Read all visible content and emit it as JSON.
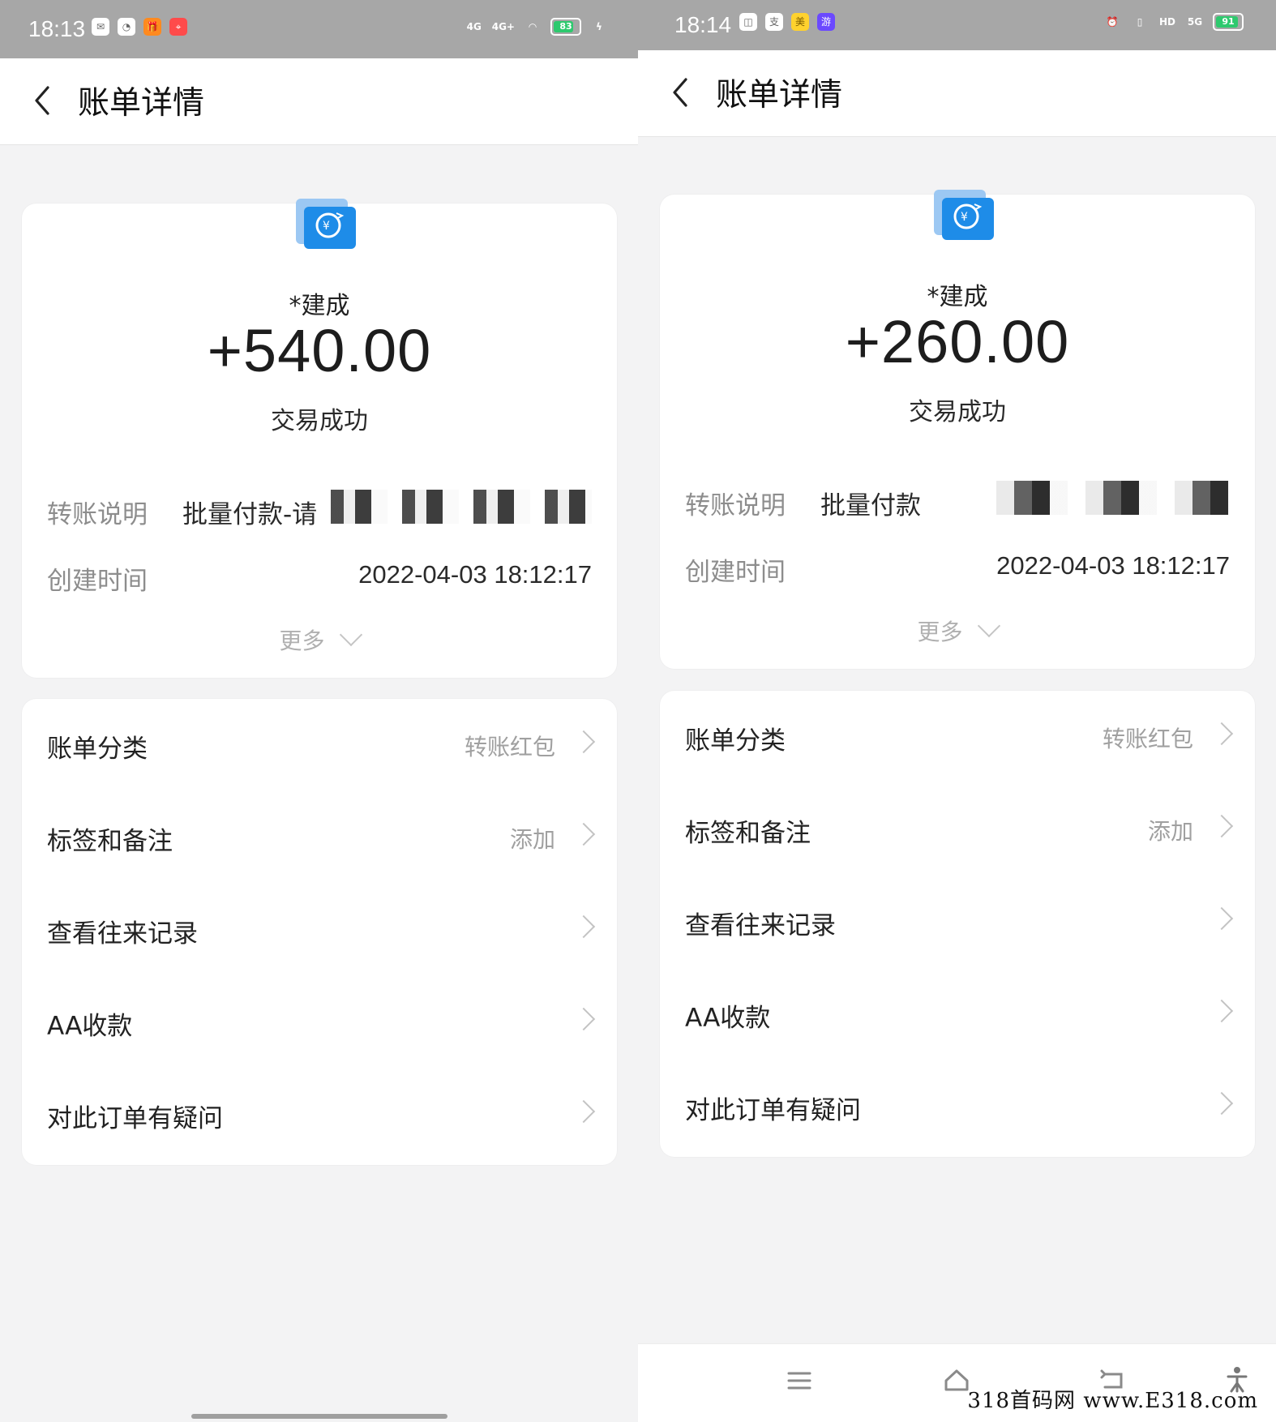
{
  "screens": [
    {
      "status": {
        "time": "18:13",
        "apps": [
          "mail",
          "compass",
          "gift",
          "map"
        ],
        "signals": [
          "4G",
          "4G+"
        ],
        "battery": "83",
        "battery_fill": 0.83
      },
      "nav": {
        "title": "账单详情"
      },
      "summary": {
        "name": "*建成",
        "amount": "+540.00",
        "status": "交易成功",
        "rows": [
          {
            "label": "转账说明",
            "value": "批量付款-请"
          },
          {
            "label": "创建时间",
            "value": "2022-04-03 18:12:17"
          }
        ],
        "more": "更多"
      },
      "menu": [
        {
          "label": "账单分类",
          "value": "转账红包"
        },
        {
          "label": "标签和备注",
          "value": "添加"
        },
        {
          "label": "查看往来记录",
          "value": ""
        },
        {
          "label": "AA收款",
          "value": ""
        },
        {
          "label": "对此订单有疑问",
          "value": ""
        }
      ]
    },
    {
      "status": {
        "time": "18:14",
        "apps": [
          "voice",
          "alipay",
          "meituan",
          "game"
        ],
        "signals": [
          "HD",
          "5G"
        ],
        "battery": "91",
        "battery_fill": 0.91
      },
      "nav": {
        "title": "账单详情"
      },
      "summary": {
        "name": "*建成",
        "amount": "+260.00",
        "status": "交易成功",
        "rows": [
          {
            "label": "转账说明",
            "value": "批量付款"
          },
          {
            "label": "创建时间",
            "value": "2022-04-03 18:12:17"
          }
        ],
        "more": "更多"
      },
      "menu": [
        {
          "label": "账单分类",
          "value": "转账红包"
        },
        {
          "label": "标签和备注",
          "value": "添加"
        },
        {
          "label": "查看往来记录",
          "value": ""
        },
        {
          "label": "AA收款",
          "value": ""
        },
        {
          "label": "对此订单有疑问",
          "value": ""
        }
      ]
    }
  ],
  "watermark": "318首码网 www.E318.com",
  "colors": {
    "status_bar": "#a7a7a7",
    "page_bg": "#f3f3f4",
    "card_bg": "#ffffff",
    "accent_blue": "#1e8ce8",
    "battery_green": "#2ec96e"
  }
}
